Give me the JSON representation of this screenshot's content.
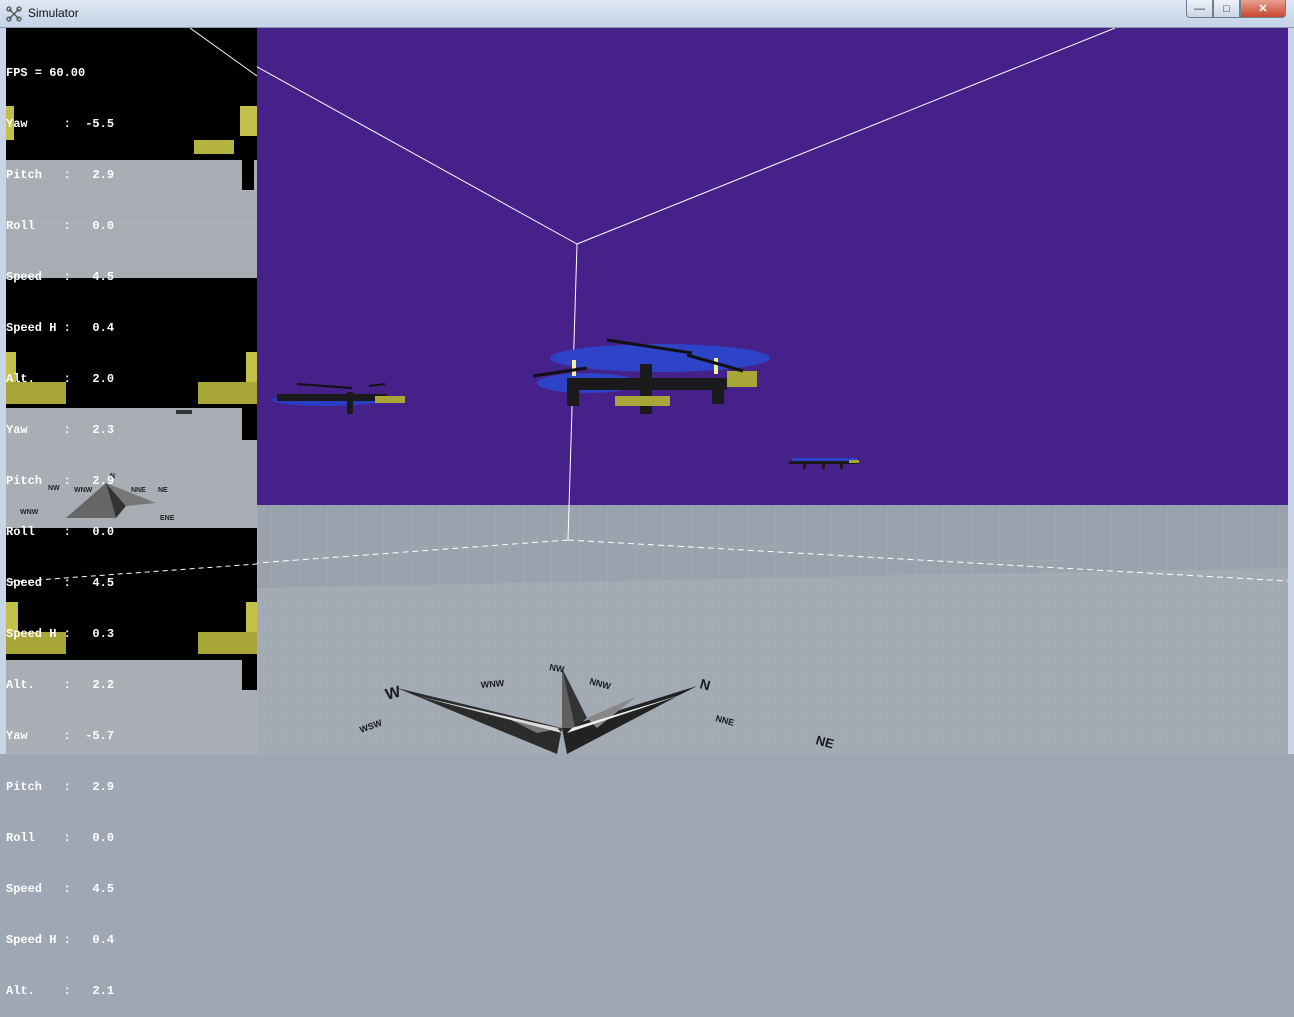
{
  "window": {
    "title": "Simulator",
    "icon": "drone-icon",
    "controls": {
      "minimize": "—",
      "maximize": "□",
      "close": "✕"
    }
  },
  "hud": {
    "fps": "FPS = 60.00",
    "drones": [
      {
        "yaw": "Yaw     :  -5.5",
        "pitch": "Pitch   :   2.9",
        "roll": "Roll    :   0.0",
        "speed": "Speed   :   4.5",
        "speed_h": "Speed H :   0.4",
        "alt": "Alt.    :   2.0"
      },
      {
        "yaw": "Yaw     :   2.3",
        "pitch": "Pitch   :   2.9",
        "roll": "Roll    :   0.0",
        "speed": "Speed   :   4.5",
        "speed_h": "Speed H :   0.3",
        "alt": "Alt.    :   2.2"
      },
      {
        "yaw": "Yaw     :  -5.7",
        "pitch": "Pitch   :   2.9",
        "roll": "Roll    :   0.0",
        "speed": "Speed   :   4.5",
        "speed_h": "Speed H :   0.4",
        "alt": "Alt.    :   2.1"
      }
    ]
  },
  "scene": {
    "sky_color": "#47218a",
    "floor_color": "#9aa3ad",
    "compass_main": [
      "W",
      "N",
      "NE",
      "NW",
      "WNW",
      "NNW",
      "NNE",
      "WSW"
    ],
    "compass_cam": [
      "N",
      "NW",
      "NNE",
      "WNW",
      "NE",
      "WNW",
      "ENE"
    ]
  }
}
